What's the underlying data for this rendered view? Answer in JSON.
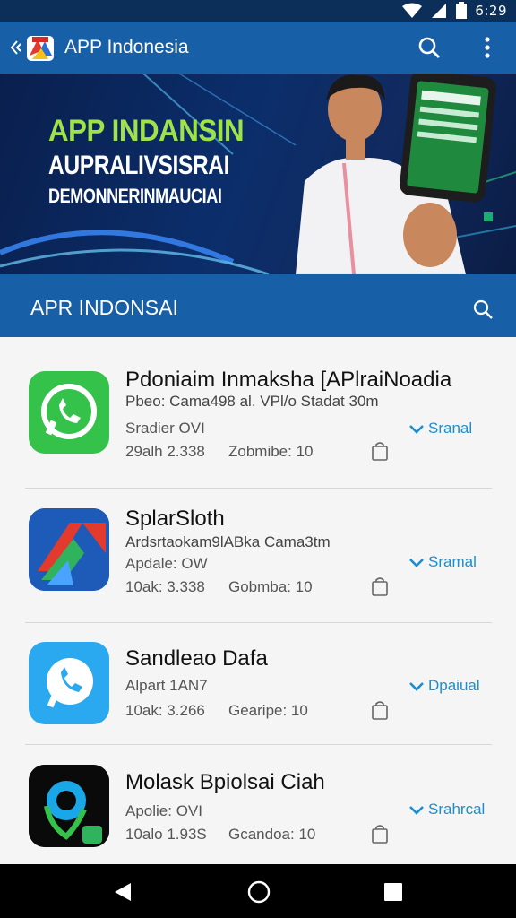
{
  "status_bar": {
    "time": "6:29"
  },
  "app_bar": {
    "title": "APP Indonesia"
  },
  "banner": {
    "line1": "APP INDANSIN",
    "line2": "AUPRALIVSISRAI",
    "line3": "DEMONNERINMAUCIAI"
  },
  "section": {
    "title": "APR INDONSAI"
  },
  "apps": [
    {
      "name": "Pdoniaim Inmaksha [APlraiNoadia",
      "subtitle": "Pbeo: Cama498 al. VPl/o Stadat 30m",
      "meta_left": "Sradier OVI",
      "stat_left": "29alh 2.338",
      "stat_right": "Zobmibe: 10",
      "action": "Sranal",
      "icon": "whatsapp-icon",
      "color": "#34c24a"
    },
    {
      "name": "SplarSloth",
      "subtitle": "Ardsrtaokam9lABka Cama3tm",
      "meta_left": "Apdale: OW",
      "stat_left": "10ak: 3.338",
      "stat_right": "Gobmba: 10",
      "action": "Sramal",
      "icon": "arrow-logo-icon",
      "color": "#1e5bb8"
    },
    {
      "name": "Sandleao Dafa",
      "subtitle": "",
      "meta_left": "Alpart 1AN7",
      "stat_left": "10ak: 3.266",
      "stat_right": "Gearipe: 10",
      "action": "Dpaiual",
      "icon": "chat-phone-icon",
      "color": "#2aa9f0"
    },
    {
      "name": "Molask Bpiolsai Ciah",
      "subtitle": "",
      "meta_left": "Apolie: OVI",
      "stat_left": "10alo 1.93S",
      "stat_right": "Gcandoa: 10",
      "action": "Srahrcal",
      "icon": "map-pin-icon",
      "color": "#0a0a0a"
    }
  ]
}
